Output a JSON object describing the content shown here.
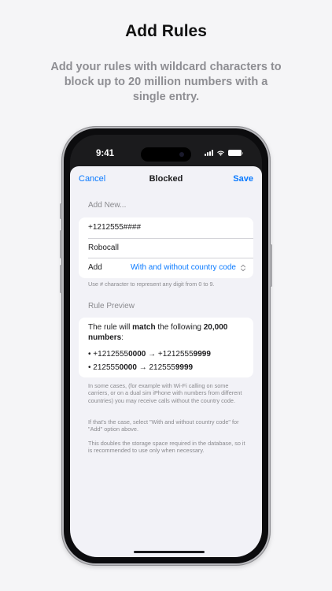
{
  "promo": {
    "title": "Add Rules",
    "subtitle": "Add your rules with wildcard characters to block up to 20 million numbers with a single entry."
  },
  "status_bar": {
    "time": "9:41",
    "icons": [
      "cellular-signal-icon",
      "wifi-icon",
      "battery-icon"
    ]
  },
  "nav": {
    "cancel_label": "Cancel",
    "title": "Blocked",
    "save_label": "Save"
  },
  "add_new": {
    "header": "Add New...",
    "number_value": "+1212555####",
    "label_value": "Robocall",
    "add_label": "Add",
    "add_option": "With and without country code",
    "hint": "Use # character to represent any digit from 0 to 9."
  },
  "rule_preview": {
    "header": "Rule Preview",
    "summary": {
      "prefix": "The rule will ",
      "emphasis1": "match",
      "middle": " the following ",
      "emphasis2": "20,000 numbers",
      "suffix": ":"
    },
    "ranges": [
      {
        "bullet": "•",
        "from_plain": "+1212555",
        "from_bold": "0000",
        "arrow": "→",
        "to_plain": "+1212555",
        "to_bold": "9999"
      },
      {
        "bullet": "•",
        "from_plain": "212555",
        "from_bold": "0000",
        "arrow": "→",
        "to_plain": "212555",
        "to_bold": "9999"
      }
    ],
    "notes": [
      "In some cases, (for example with Wi-Fi calling on some carriers, or on a dual sim iPhone with numbers from different countries) you may receive calls without the country code.",
      "If that's the case, select \"With and without country code\" for \"Add\" option above.",
      "This doubles the storage space required in the database, so it is recommended to use only when necessary."
    ]
  },
  "colors": {
    "accent": "#0a7aff",
    "background": "#f2f2f7",
    "secondary_text": "#8a8a8e"
  }
}
